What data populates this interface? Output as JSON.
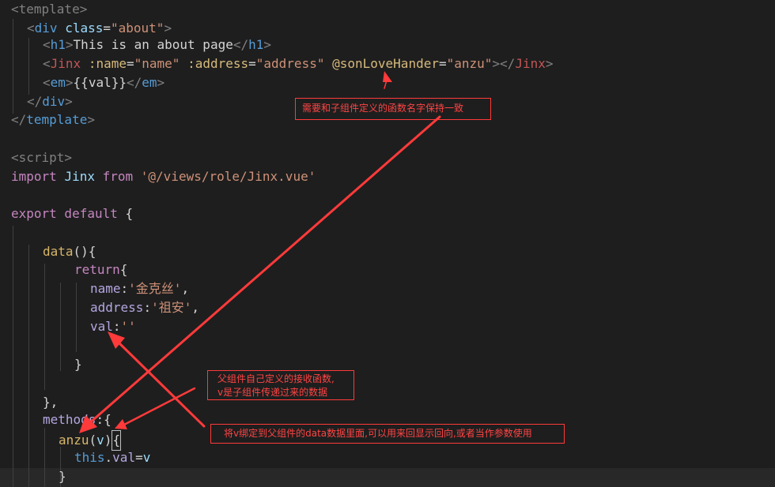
{
  "code": {
    "template_open": "<template>",
    "div_open_tag": "div",
    "div_class_attr": "class",
    "div_class_value": "\"about\"",
    "h1_tag": "h1",
    "h1_text": "This is an about page",
    "jinx_tag": "Jinx",
    "jinx_attr_name": ":name",
    "jinx_val_name": "\"name\"",
    "jinx_attr_address": ":address",
    "jinx_val_address": "\"address\"",
    "jinx_event": "@sonLoveHander",
    "jinx_event_val": "\"anzu\"",
    "em_tag": "em",
    "em_expr": "{{val}}",
    "div_close_tag": "div",
    "template_close": "template",
    "script_open": "<script>",
    "import_kw": "import",
    "import_name": "Jinx",
    "from_kw": "from",
    "import_path": "'@/views/role/Jinx.vue'",
    "export_kw": "export default",
    "data_fn": "data",
    "return_kw": "return",
    "prop_name": "name",
    "prop_name_val": "'金克丝'",
    "prop_address": "address",
    "prop_address_val": "'祖安'",
    "prop_val": "val",
    "prop_val_val": "''",
    "methods_kw": "methods",
    "anzu_fn": "anzu",
    "anzu_param": "v",
    "this_kw": "this",
    "this_prop": "val",
    "assign_val": "v"
  },
  "annotations": {
    "note_function_name": "需要和子组件定义的函数名字保持一致",
    "note_receiver_line1": "父组件自己定义的接收函数,",
    "note_receiver_line2": "v是子组件传递过来的数据",
    "note_bind_data": "将v绑定到父组件的data数据里面,可以用来回显示回向,或者当作参数使用"
  },
  "colors": {
    "background": "#1e1e1e",
    "annotation_red": "#ff3a3a"
  }
}
